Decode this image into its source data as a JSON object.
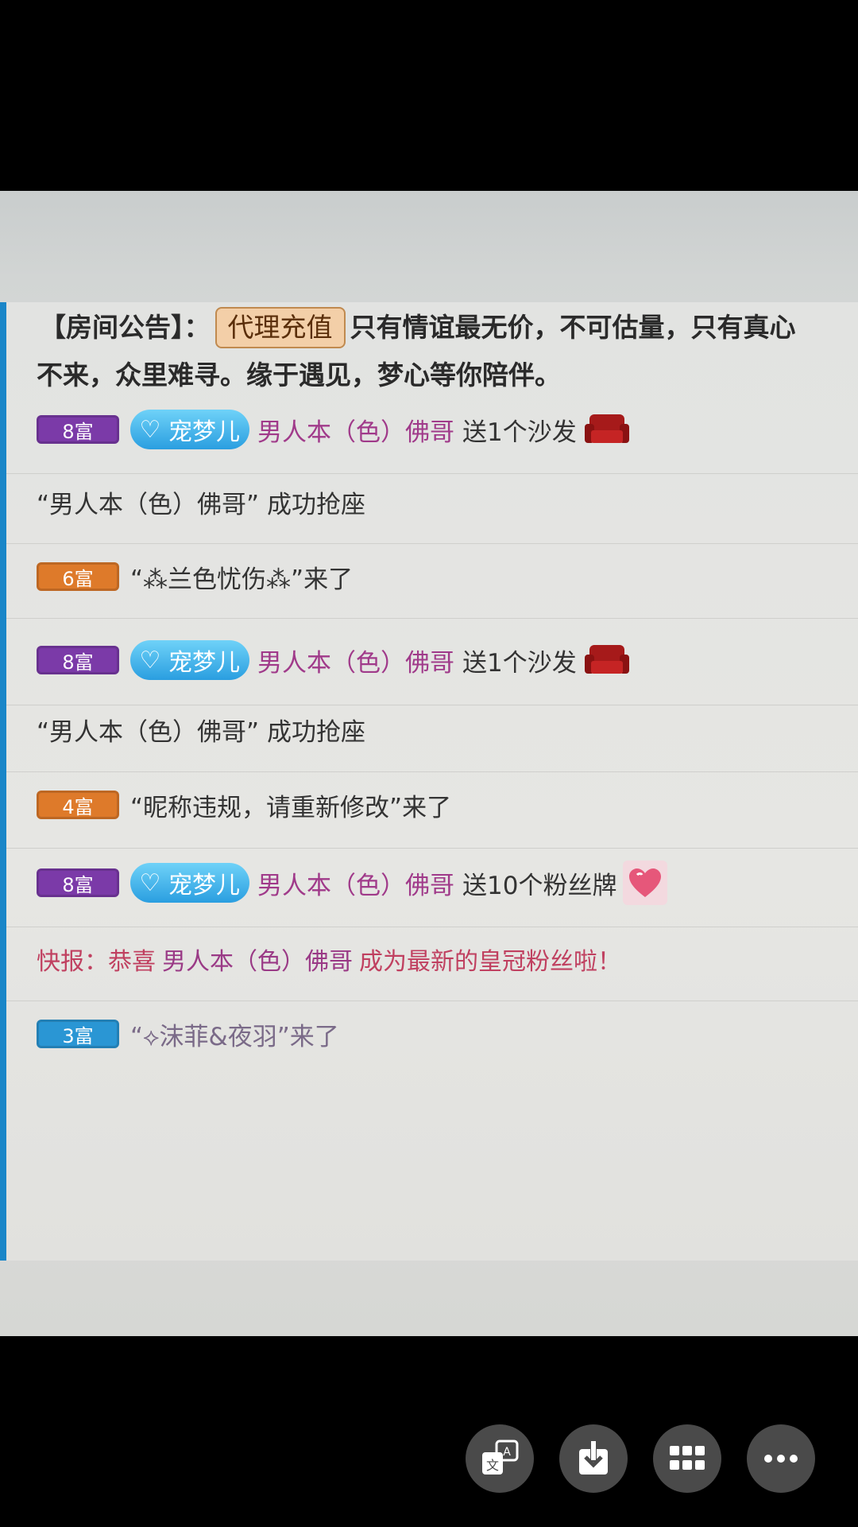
{
  "announcement": {
    "label": "【房间公告】：",
    "button": "代理充值",
    "text_line1": "只有情谊最无价，不可估量，只有真心",
    "text_line2": "不来，众里难寻。缘于遇见，梦心等你陪伴。"
  },
  "messages": [
    {
      "type": "gift",
      "rank": "8富",
      "pet": "宠梦儿",
      "user": "男人本（色）佛哥",
      "action": "送1个沙发",
      "gift_icon": "sofa-icon"
    },
    {
      "type": "system",
      "text": "“男人本（色）佛哥” 成功抢座"
    },
    {
      "type": "enter",
      "rank": "6富",
      "text": "“⁂兰色忧伤⁂”来了"
    },
    {
      "type": "gift",
      "rank": "8富",
      "pet": "宠梦儿",
      "user": "男人本（色）佛哥",
      "action": "送1个沙发",
      "gift_icon": "sofa-icon"
    },
    {
      "type": "system",
      "text": "“男人本（色）佛哥” 成功抢座"
    },
    {
      "type": "enter",
      "rank": "4富",
      "text": "“昵称违规，请重新修改”来了"
    },
    {
      "type": "gift",
      "rank": "8富",
      "pet": "宠梦儿",
      "user": "男人本（色）佛哥",
      "action": "送10个粉丝牌",
      "gift_icon": "fan-badge-icon"
    },
    {
      "type": "news",
      "prefix": "快报：恭喜",
      "user": "男人本（色）佛哥",
      "suffix": "成为最新的皇冠粉丝啦！"
    },
    {
      "type": "enter",
      "rank": "3富",
      "text": "“⟡沫菲&夜羽”来了"
    }
  ],
  "toolbar": {
    "translate_icon": "translate-icon",
    "download_icon": "download-icon",
    "grid_icon": "grid-icon",
    "more_icon": "more-icon"
  },
  "colors": {
    "rank_purple": "#7b3aa8",
    "rank_orange": "#de7a2a",
    "rank_blue": "#2a96d4",
    "username": "#a03a8a",
    "news": "#c04060"
  }
}
